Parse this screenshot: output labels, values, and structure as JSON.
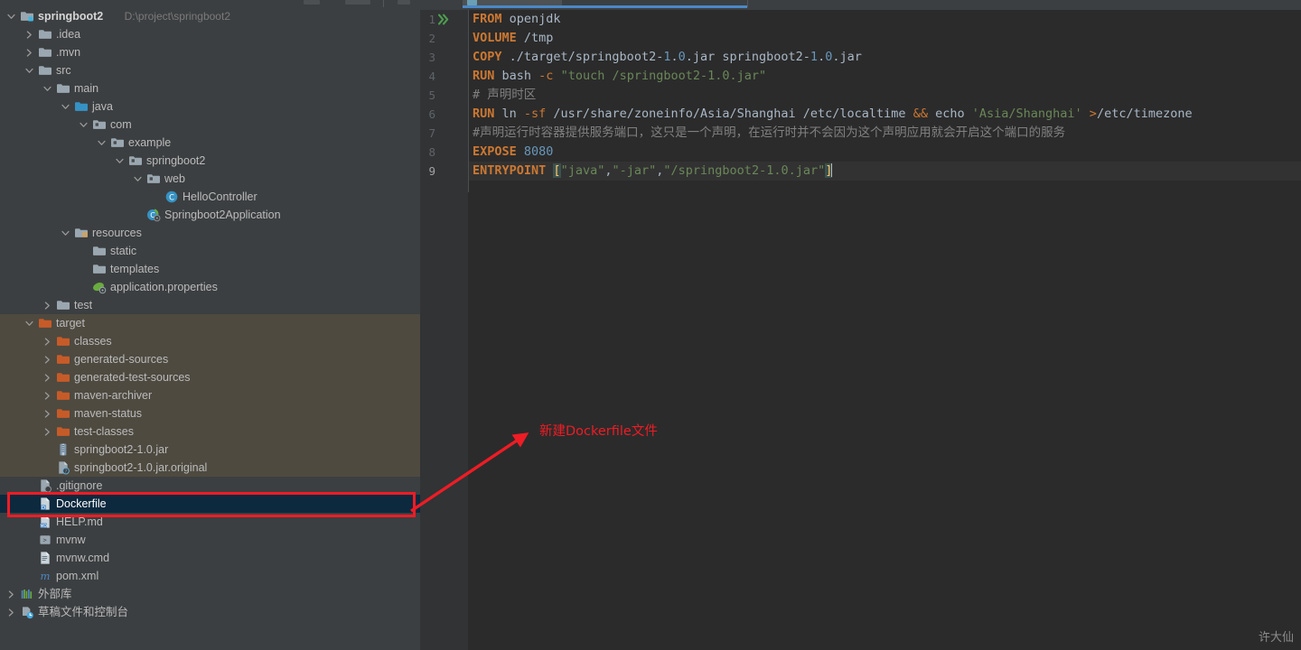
{
  "window": {
    "watermark": "许大仙"
  },
  "sidebar": {
    "project_name": "springboot2",
    "project_path": "D:\\project\\springboot2",
    "tree": [
      {
        "label": "springboot2",
        "path": "D:\\project\\springboot2",
        "depth": 0,
        "arrow": "down",
        "icon": "module-folder-icon",
        "bold": true
      },
      {
        "label": ".idea",
        "depth": 1,
        "arrow": "right",
        "icon": "folder-icon"
      },
      {
        "label": ".mvn",
        "depth": 1,
        "arrow": "right",
        "icon": "folder-icon"
      },
      {
        "label": "src",
        "depth": 1,
        "arrow": "down",
        "icon": "folder-icon"
      },
      {
        "label": "main",
        "depth": 2,
        "arrow": "down",
        "icon": "folder-icon"
      },
      {
        "label": "java",
        "depth": 3,
        "arrow": "down",
        "icon": "source-folder-icon"
      },
      {
        "label": "com",
        "depth": 4,
        "arrow": "down",
        "icon": "package-icon"
      },
      {
        "label": "example",
        "depth": 5,
        "arrow": "down",
        "icon": "package-icon"
      },
      {
        "label": "springboot2",
        "depth": 6,
        "arrow": "down",
        "icon": "package-icon"
      },
      {
        "label": "web",
        "depth": 7,
        "arrow": "down",
        "icon": "package-icon"
      },
      {
        "label": "HelloController",
        "depth": 8,
        "arrow": "none",
        "icon": "java-class-icon"
      },
      {
        "label": "Springboot2Application",
        "depth": 7,
        "arrow": "none",
        "icon": "spring-boot-class-icon"
      },
      {
        "label": "resources",
        "depth": 3,
        "arrow": "down",
        "icon": "resources-folder-icon"
      },
      {
        "label": "static",
        "depth": 4,
        "arrow": "none",
        "icon": "folder-icon"
      },
      {
        "label": "templates",
        "depth": 4,
        "arrow": "none",
        "icon": "folder-icon"
      },
      {
        "label": "application.properties",
        "depth": 4,
        "arrow": "none",
        "icon": "spring-properties-icon"
      },
      {
        "label": "test",
        "depth": 2,
        "arrow": "right",
        "icon": "test-folder-icon"
      },
      {
        "label": "target",
        "depth": 1,
        "arrow": "down",
        "icon": "excluded-folder-icon",
        "zone": "target"
      },
      {
        "label": "classes",
        "depth": 2,
        "arrow": "right",
        "icon": "excluded-folder-icon",
        "zone": "target"
      },
      {
        "label": "generated-sources",
        "depth": 2,
        "arrow": "right",
        "icon": "excluded-folder-icon",
        "zone": "target"
      },
      {
        "label": "generated-test-sources",
        "depth": 2,
        "arrow": "right",
        "icon": "excluded-folder-icon",
        "zone": "target"
      },
      {
        "label": "maven-archiver",
        "depth": 2,
        "arrow": "right",
        "icon": "excluded-folder-icon",
        "zone": "target"
      },
      {
        "label": "maven-status",
        "depth": 2,
        "arrow": "right",
        "icon": "excluded-folder-icon",
        "zone": "target"
      },
      {
        "label": "test-classes",
        "depth": 2,
        "arrow": "right",
        "icon": "excluded-folder-icon",
        "zone": "target"
      },
      {
        "label": "springboot2-1.0.jar",
        "depth": 2,
        "arrow": "none",
        "icon": "jar-icon",
        "zone": "target"
      },
      {
        "label": "springboot2-1.0.jar.original",
        "depth": 2,
        "arrow": "none",
        "icon": "unknown-file-icon",
        "zone": "target"
      },
      {
        "label": ".gitignore",
        "depth": 1,
        "arrow": "none",
        "icon": "gitignore-icon"
      },
      {
        "label": "Dockerfile",
        "depth": 1,
        "arrow": "none",
        "icon": "dockerfile-icon",
        "selected": true
      },
      {
        "label": "HELP.md",
        "depth": 1,
        "arrow": "none",
        "icon": "markdown-icon"
      },
      {
        "label": "mvnw",
        "depth": 1,
        "arrow": "none",
        "icon": "shell-script-icon"
      },
      {
        "label": "mvnw.cmd",
        "depth": 1,
        "arrow": "none",
        "icon": "cmd-script-icon"
      },
      {
        "label": "pom.xml",
        "depth": 1,
        "arrow": "none",
        "icon": "maven-pom-icon"
      },
      {
        "label": "外部库",
        "depth": 0,
        "arrow": "right",
        "icon": "external-libraries-icon"
      },
      {
        "label": "草稿文件和控制台",
        "depth": 0,
        "arrow": "right",
        "icon": "scratches-consoles-icon"
      }
    ]
  },
  "editor": {
    "tab_label": "",
    "lines": [
      {
        "number": "1",
        "run_marker": true,
        "tokens": [
          {
            "t": "FROM",
            "c": "kw"
          },
          {
            "t": " openjdk",
            "c": "txt"
          }
        ]
      },
      {
        "number": "2",
        "tokens": [
          {
            "t": "VOLUME",
            "c": "kw"
          },
          {
            "t": " /tmp",
            "c": "txt"
          }
        ]
      },
      {
        "number": "3",
        "tokens": [
          {
            "t": "COPY",
            "c": "kw"
          },
          {
            "t": " ./target/springboot2-",
            "c": "txt"
          },
          {
            "t": "1",
            "c": "num"
          },
          {
            "t": ".",
            "c": "txt"
          },
          {
            "t": "0",
            "c": "num"
          },
          {
            "t": ".jar springboot2-",
            "c": "txt"
          },
          {
            "t": "1",
            "c": "num"
          },
          {
            "t": ".",
            "c": "txt"
          },
          {
            "t": "0",
            "c": "num"
          },
          {
            "t": ".jar",
            "c": "txt"
          }
        ]
      },
      {
        "number": "4",
        "tokens": [
          {
            "t": "RUN",
            "c": "kw"
          },
          {
            "t": " bash ",
            "c": "txt"
          },
          {
            "t": "-c",
            "c": "kwn"
          },
          {
            "t": " ",
            "c": "txt"
          },
          {
            "t": "\"touch /springboot2-1.0.jar\"",
            "c": "str"
          }
        ]
      },
      {
        "number": "5",
        "tokens": [
          {
            "t": "# 声明时区",
            "c": "cmt"
          }
        ]
      },
      {
        "number": "6",
        "tokens": [
          {
            "t": "RUN",
            "c": "kw"
          },
          {
            "t": " ln ",
            "c": "txt"
          },
          {
            "t": "-sf",
            "c": "kwn"
          },
          {
            "t": " /usr/share/zoneinfo/Asia/Shanghai /etc/localtime ",
            "c": "txt"
          },
          {
            "t": "&&",
            "c": "kwn"
          },
          {
            "t": " echo ",
            "c": "txt"
          },
          {
            "t": "'Asia/Shanghai'",
            "c": "str"
          },
          {
            "t": " ",
            "c": "txt"
          },
          {
            "t": ">",
            "c": "kwn"
          },
          {
            "t": "/etc/timezone",
            "c": "txt"
          }
        ]
      },
      {
        "number": "7",
        "tokens": [
          {
            "t": "#声明运行时容器提供服务端口，这只是一个声明，在运行时并不会因为这个声明应用就会开启这个端口的服务",
            "c": "cmt"
          }
        ]
      },
      {
        "number": "8",
        "tokens": [
          {
            "t": "EXPOSE",
            "c": "kw"
          },
          {
            "t": " ",
            "c": "txt"
          },
          {
            "t": "8080",
            "c": "num"
          }
        ]
      },
      {
        "number": "9",
        "current": true,
        "caret": true,
        "tokens": [
          {
            "t": "ENTRYPOINT",
            "c": "kw"
          },
          {
            "t": " ",
            "c": "txt"
          },
          {
            "t": "[",
            "c": "brk"
          },
          {
            "t": "\"java\"",
            "c": "str"
          },
          {
            "t": ",",
            "c": "txt"
          },
          {
            "t": "\"-jar\"",
            "c": "str"
          },
          {
            "t": ",",
            "c": "txt"
          },
          {
            "t": "\"/springboot2-1.0.jar\"",
            "c": "str"
          },
          {
            "t": "]",
            "c": "brk"
          }
        ]
      }
    ]
  },
  "annotation": {
    "text": "新建Dockerfile文件",
    "color": "#ee1c25"
  },
  "colors": {
    "sidebar_bg": "#3c3f41",
    "editor_bg": "#2b2b2b",
    "gutter_bg": "#313335",
    "selection_bg": "#0d293e",
    "excluded_zone_bg": "#4e4a40",
    "keyword": "#cc7832",
    "string": "#6a8759",
    "number": "#6897bb",
    "comment": "#808080",
    "text": "#a9b7c6",
    "annotation_red": "#ee1c25"
  }
}
